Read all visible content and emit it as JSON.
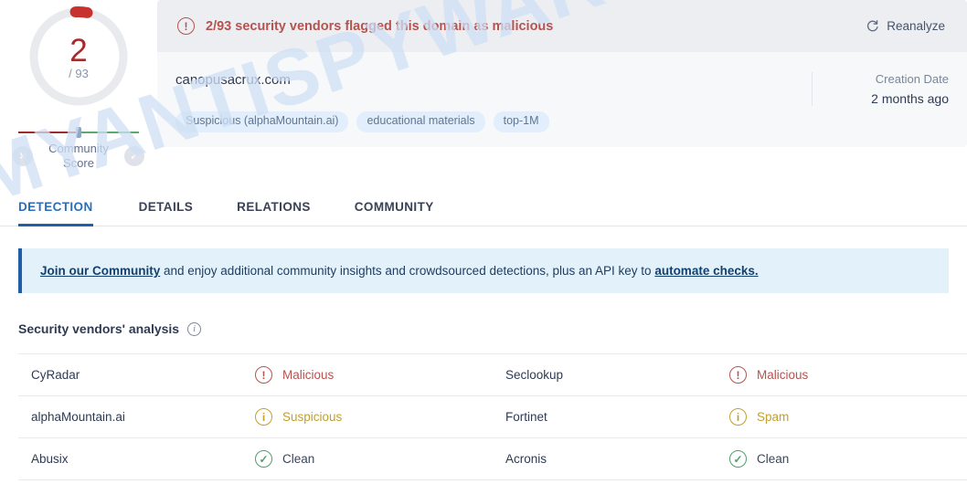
{
  "watermark": {
    "text": "MYANTISPYWARE.COM"
  },
  "score": {
    "value": "2",
    "total": "/ 93",
    "ring_color": "#c8322e",
    "value_color": "#a82a2a",
    "community": {
      "label_line1": "Community",
      "label_line2": "Score",
      "negative_icon": "close-circle-icon",
      "positive_icon": "check-circle-icon"
    }
  },
  "alert": {
    "icon": "exclamation-circle-icon",
    "icon_glyph": "!",
    "text": "2/93 security vendors flagged this domain as malicious",
    "color": "#b5534f",
    "reanalyze": {
      "label": "Reanalyze",
      "icon": "refresh-icon",
      "icon_glyph": "⟳"
    }
  },
  "info": {
    "domain": "canopusacrux.com",
    "tags": [
      "Suspicious (alphaMountain.ai)",
      "educational materials",
      "top-1M"
    ],
    "creation_label": "Creation Date",
    "creation_value": "2 months ago"
  },
  "tabs": [
    {
      "label": "DETECTION",
      "active": true
    },
    {
      "label": "DETAILS",
      "active": false
    },
    {
      "label": "RELATIONS",
      "active": false
    },
    {
      "label": "COMMUNITY",
      "active": false
    }
  ],
  "banner": {
    "link1": "Join our Community",
    "middle": " and enjoy additional community insights and crowdsourced detections, plus an API key to ",
    "link2": "automate checks.",
    "accent_color": "#1f5fa8"
  },
  "vendors_section": {
    "title": "Security vendors' analysis",
    "info_icon": "info-circle-icon",
    "rows": [
      {
        "left": {
          "name": "CyRadar",
          "verdict": "Malicious",
          "status": "malicious",
          "icon": "exclamation-circle-icon",
          "glyph": "!"
        },
        "right": {
          "name": "Seclookup",
          "verdict": "Malicious",
          "status": "malicious",
          "icon": "exclamation-circle-icon",
          "glyph": "!"
        }
      },
      {
        "left": {
          "name": "alphaMountain.ai",
          "verdict": "Suspicious",
          "status": "suspicious",
          "icon": "info-circle-icon",
          "glyph": "i"
        },
        "right": {
          "name": "Fortinet",
          "verdict": "Spam",
          "status": "spam",
          "icon": "info-circle-icon",
          "glyph": "i"
        }
      },
      {
        "left": {
          "name": "Abusix",
          "verdict": "Clean",
          "status": "clean",
          "icon": "check-circle-icon",
          "glyph": "✓"
        },
        "right": {
          "name": "Acronis",
          "verdict": "Clean",
          "status": "clean",
          "icon": "check-circle-icon",
          "glyph": "✓"
        }
      }
    ]
  }
}
